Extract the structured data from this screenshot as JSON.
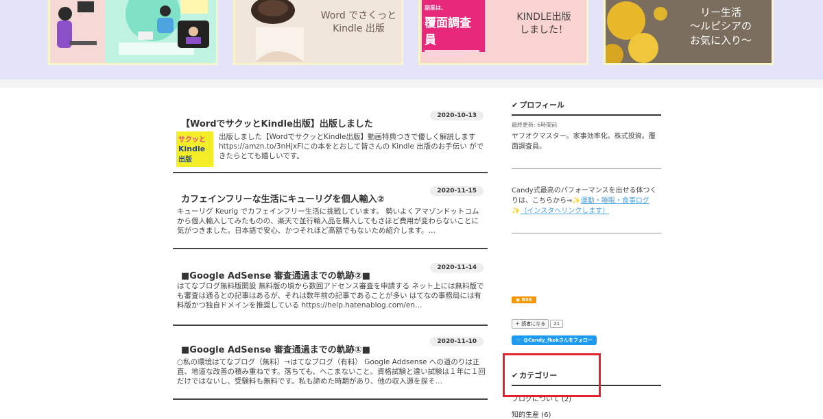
{
  "featured": {
    "card2": {
      "title_line1": "Word でさくっと",
      "title_line2": "Kindle 出版"
    },
    "card3": {
      "title_line1": "KINDLE出版",
      "title_line2": "しました！",
      "book_tag": "副業は、",
      "book_title": "覆面調査員"
    },
    "card4": {
      "title_line1": "リー生活",
      "title_line2": "～ルピシアの",
      "title_line3": "お気に入り～"
    }
  },
  "entries": [
    {
      "date": "2020-10-13",
      "title": "【WordでサクッとKindle出版】出版しました",
      "body": "出版しました【WordでサクッとKindle出版】動画特典つきで優しく解説します https://amzn.to/3nHjxFIこの本をとおして皆さんの Kindle 出版のお手伝い ができたらとても嬉しいです。",
      "thumb": {
        "line1": "サクッと",
        "line2": "Kindle",
        "line3": "出版"
      }
    },
    {
      "date": "2020-11-15",
      "title": "カフェインフリーな生活にキューリグを個人輸入②",
      "body": "キューリグ Keurig でカフェインフリー生活に挑戦しています。 勢いよくアマゾンドットコムから個人輸入してみたものの、楽天で並行輸入品を購入してもさほど費用が変わらないことに気がつきました。日本語で安心、かつそれほど高額でもないため紹介します。…"
    },
    {
      "date": "2020-11-14",
      "title": "■Google AdSense 審査通過までの軌跡②■",
      "body": "はてなブログ無料版開設 無料版の頃から数回アドセンス審査を申請する ネット上には無料版でも審査は通るとの記事はあるが、それは数年前の記事であることが多い はてなの事務局には有料版かつ独自ドメインを推奨している https://help.hatenablog.com/en…"
    },
    {
      "date": "2020-11-10",
      "title": "■Google AdSense 審査通過までの軌跡①■",
      "body": "○私の環境はてなブログ（無料）→はてなブログ（有料） Google Addsense への道のりは正直、地道な改善の積み重ねです。落ちても、へこまないこと。資格試験と違い試験は１年に１回だけではないし、受験料も無料です。私も諦めた時期があり、他の収入源を探そ…"
    }
  ],
  "sidebar": {
    "profile_heading": "プロフィール",
    "last_updated": "最終更新: 6時間前",
    "profile_desc": "ヤフオクマスター。家事効率化。株式投資。覆面調査員。",
    "candy_text": "Candy式最高のパフォーマンスを出せる体つくりは、こちらから⇒",
    "candy_link": "運動・睡眠・食事ログ",
    "candy_link2": "（インスタへリンクします）",
    "rss_label": "RSS",
    "reader_label": "読者になる",
    "reader_count": "21",
    "twitter_label": "@Candy_fkokさんをフォロー",
    "category_heading": "カテゴリー",
    "categories": [
      "ブログについて (2)",
      "知的生産 (6)"
    ]
  }
}
